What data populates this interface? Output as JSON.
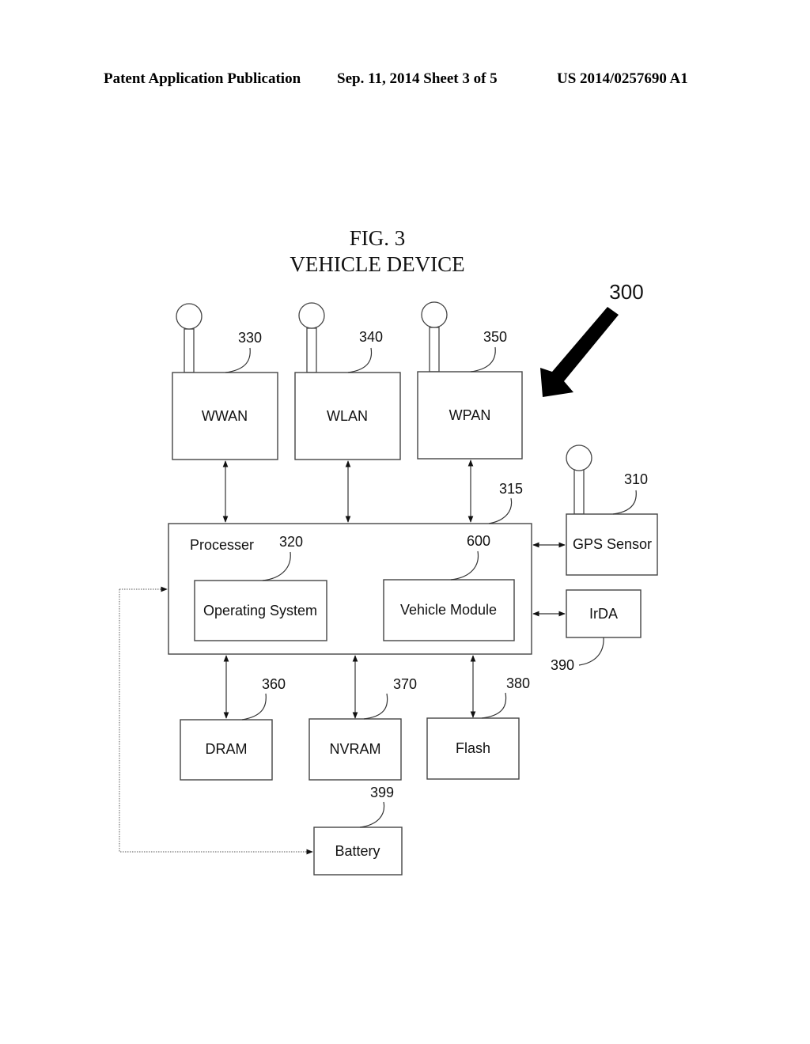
{
  "header": {
    "publication": "Patent Application Publication",
    "date_sheet": "Sep. 11, 2014   Sheet 3 of 5",
    "number": "US 2014/0257690 A1"
  },
  "figure": {
    "number": "FIG. 3",
    "title": "VEHICLE DEVICE",
    "ref": "300"
  },
  "blocks": {
    "wwan": {
      "label": "WWAN",
      "ref": "330"
    },
    "wlan": {
      "label": "WLAN",
      "ref": "340"
    },
    "wpan": {
      "label": "WPAN",
      "ref": "350"
    },
    "processor": {
      "label": "Processer",
      "ref": "315"
    },
    "os": {
      "label": "Operating System",
      "ref": "320"
    },
    "vehicle_module": {
      "label": "Vehicle Module",
      "ref": "600"
    },
    "gps": {
      "label": "GPS Sensor",
      "ref": "310"
    },
    "irda": {
      "label": "IrDA",
      "ref": "390"
    },
    "dram": {
      "label": "DRAM",
      "ref": "360"
    },
    "nvram": {
      "label": "NVRAM",
      "ref": "370"
    },
    "flash": {
      "label": "Flash",
      "ref": "380"
    },
    "battery": {
      "label": "Battery",
      "ref": "399"
    }
  }
}
